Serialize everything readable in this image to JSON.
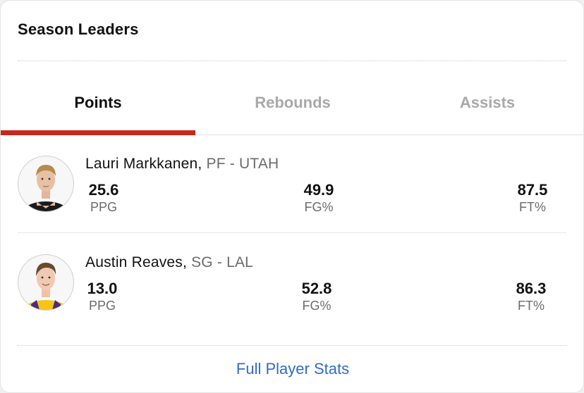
{
  "widget": {
    "title": "Season Leaders"
  },
  "tabs": [
    {
      "label": "Points",
      "active": true
    },
    {
      "label": "Rebounds",
      "active": false
    },
    {
      "label": "Assists",
      "active": false
    }
  ],
  "players": [
    {
      "name": "Lauri Markkanen,",
      "position": "PF - UTAH",
      "stats": [
        {
          "value": "25.6",
          "label": "PPG"
        },
        {
          "value": "49.9",
          "label": "FG%"
        },
        {
          "value": "87.5",
          "label": "FT%"
        }
      ],
      "jersey_color": "#1a1a1a"
    },
    {
      "name": "Austin Reaves,",
      "position": "SG - LAL",
      "stats": [
        {
          "value": "13.0",
          "label": "PPG"
        },
        {
          "value": "52.8",
          "label": "FG%"
        },
        {
          "value": "86.3",
          "label": "FT%"
        }
      ],
      "jersey_color": "#f5c518"
    }
  ],
  "footer": {
    "link_label": "Full Player Stats"
  },
  "colors": {
    "accent": "#c9271c",
    "link": "#2f6dc4"
  }
}
